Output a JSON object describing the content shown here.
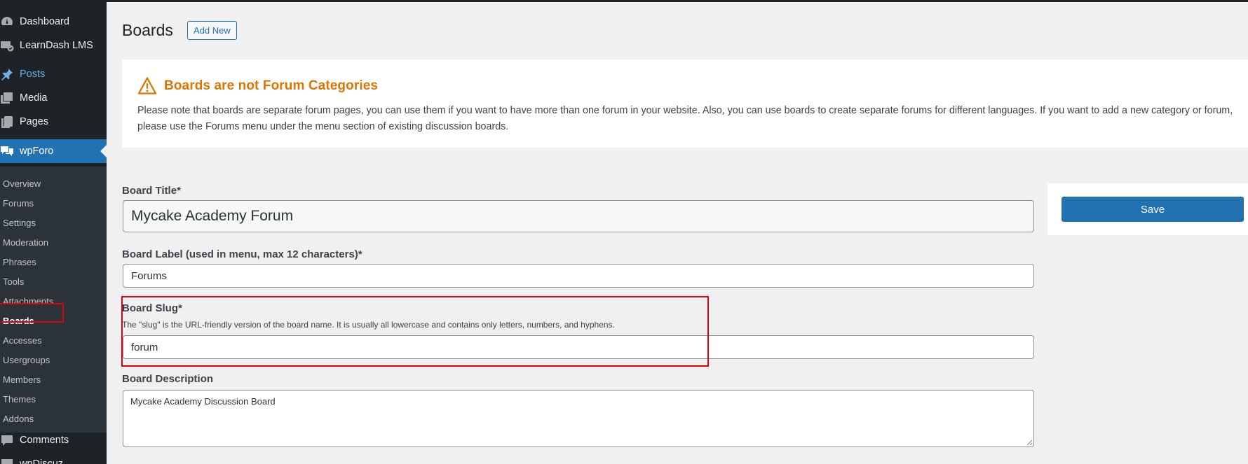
{
  "sidebar": {
    "top_items": [
      {
        "label": "Dashboard",
        "icon": "dashboard-icon"
      },
      {
        "label": "LearnDash LMS",
        "icon": "learndash-icon"
      },
      {
        "label": "Posts",
        "icon": "pin-icon"
      },
      {
        "label": "Media",
        "icon": "media-icon"
      },
      {
        "label": "Pages",
        "icon": "pages-icon"
      },
      {
        "label": "wpForo",
        "icon": "forum-icon"
      }
    ],
    "submenu": [
      "Overview",
      "Forums",
      "Settings",
      "Moderation",
      "Phrases",
      "Tools",
      "Attachments",
      "Boards",
      "Accesses",
      "Usergroups",
      "Members",
      "Themes",
      "Addons"
    ],
    "bottom_items": [
      {
        "label": "Comments",
        "icon": "comments-icon"
      },
      {
        "label": "wpDiscuz",
        "icon": "wpdiscuz-icon"
      }
    ],
    "active_submenu": "Boards"
  },
  "header": {
    "title": "Boards",
    "add_new_label": "Add New"
  },
  "notice": {
    "title": "Boards are not Forum Categories",
    "text": "Please note that boards are separate forum pages, you can use them if you want to have more than one forum in your website. Also, you can use boards to create separate forums for different languages. If you want to add a new category or forum, please use the Forums menu under the menu section of existing discussion boards.",
    "color": "#dd7500"
  },
  "form": {
    "title_label": "Board Title*",
    "title_value": "Mycake Academy Forum",
    "menu_label_label": "Board Label (used in menu, max 12 characters)*",
    "menu_label_value": "Forums",
    "slug_label": "Board Slug*",
    "slug_desc": "The \"slug\" is the URL-friendly version of the board name. It is usually all lowercase and contains only letters, numbers, and hyphens.",
    "slug_value": "forum",
    "desc_label": "Board Description",
    "desc_value": "Mycake Academy Discussion Board"
  },
  "actions": {
    "save_label": "Save"
  },
  "colors": {
    "accent": "#2271b1",
    "sidebar_bg": "#1d2327",
    "highlight": "#e0000f"
  }
}
